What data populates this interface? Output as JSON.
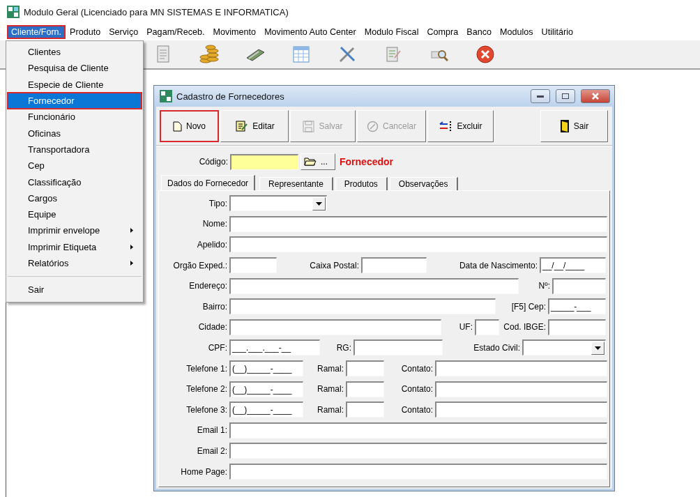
{
  "app": {
    "title": "Modulo Geral (Licenciado para MN SISTEMAS E INFORMATICA)"
  },
  "menubar": [
    {
      "label": "Cliente/Forn.",
      "selected": true,
      "outlined": true
    },
    {
      "label": "Produto",
      "selected": false,
      "outlined": false
    },
    {
      "label": "Serviço",
      "selected": false,
      "outlined": false
    },
    {
      "label": "Pagam/Receb.",
      "selected": false,
      "outlined": false
    },
    {
      "label": "Movimento",
      "selected": false,
      "outlined": false
    },
    {
      "label": "Movimento Auto Center",
      "selected": false,
      "outlined": false
    },
    {
      "label": "Modulo Fiscal",
      "selected": false,
      "outlined": false
    },
    {
      "label": "Compra",
      "selected": false,
      "outlined": false
    },
    {
      "label": "Banco",
      "selected": false,
      "outlined": false
    },
    {
      "label": "Modulos",
      "selected": false,
      "outlined": false
    },
    {
      "label": "Utilitário",
      "selected": false,
      "outlined": false
    }
  ],
  "dropdown": [
    {
      "kind": "item",
      "label": "Clientes",
      "selected": false,
      "outlined": false
    },
    {
      "kind": "item",
      "label": "Pesquisa de Cliente",
      "selected": false,
      "outlined": false
    },
    {
      "kind": "item",
      "label": "Especie de Cliente",
      "selected": false,
      "outlined": false
    },
    {
      "kind": "item",
      "label": "Fornecedor",
      "selected": true,
      "outlined": true
    },
    {
      "kind": "item",
      "label": "Funcionário",
      "selected": false,
      "outlined": false
    },
    {
      "kind": "item",
      "label": "Oficinas",
      "selected": false,
      "outlined": false
    },
    {
      "kind": "item",
      "label": "Transportadora",
      "selected": false,
      "outlined": false
    },
    {
      "kind": "item",
      "label": "Cep",
      "selected": false,
      "outlined": false
    },
    {
      "kind": "item",
      "label": "Classificação",
      "selected": false,
      "outlined": false
    },
    {
      "kind": "item",
      "label": "Cargos",
      "selected": false,
      "outlined": false
    },
    {
      "kind": "item",
      "label": "Equipe",
      "selected": false,
      "outlined": false
    },
    {
      "kind": "submenu",
      "label": "Imprimir envelope",
      "selected": false,
      "outlined": false
    },
    {
      "kind": "submenu",
      "label": "Imprimir Etiqueta",
      "selected": false,
      "outlined": false
    },
    {
      "kind": "submenu",
      "label": "Relatórios",
      "selected": false,
      "outlined": false
    },
    {
      "kind": "separator"
    },
    {
      "kind": "item",
      "label": "Sair",
      "selected": false,
      "outlined": false
    }
  ],
  "dialog": {
    "title": "Cadastro de Fornecedores",
    "buttons": [
      {
        "kind": "new",
        "label": "Novo",
        "disabled": false,
        "outlined": true
      },
      {
        "kind": "edit",
        "label": "Editar",
        "disabled": false,
        "outlined": false
      },
      {
        "kind": "save",
        "label": "Salvar",
        "disabled": true,
        "outlined": false
      },
      {
        "kind": "cancel",
        "label": "Cancelar",
        "disabled": true,
        "outlined": false
      },
      {
        "kind": "delete",
        "label": "Excluir",
        "disabled": false,
        "outlined": false
      },
      {
        "kind": "exit",
        "label": "Sair",
        "disabled": false,
        "outlined": false
      }
    ],
    "code": {
      "label": "Código:",
      "lookup": "...",
      "caption": "Fornecedor"
    },
    "tabs": [
      {
        "label": "Dados do Fornecedor",
        "selected": true
      },
      {
        "label": "Representante",
        "selected": false
      },
      {
        "label": "Produtos",
        "selected": false
      },
      {
        "label": "Observações",
        "selected": false
      }
    ],
    "rows": [
      [
        {
          "label": "Tipo:",
          "kind": "combo"
        }
      ],
      [
        {
          "label": "Nome:",
          "kind": "text"
        }
      ],
      [
        {
          "label": "Apelido:",
          "kind": "text"
        }
      ],
      [
        {
          "label": "Orgão Exped.:",
          "kind": "text"
        },
        {
          "label": "Caixa Postal:",
          "kind": "text"
        },
        {
          "label": "Data de Nascimento:",
          "kind": "text",
          "value": "__/__/____"
        }
      ],
      [
        {
          "label": "Endereço:",
          "kind": "text"
        },
        {
          "label": "Nº:",
          "kind": "text"
        }
      ],
      [
        {
          "label": "Bairro:",
          "kind": "text"
        },
        {
          "label": "[F5] Cep:",
          "kind": "text",
          "value": "_____-___"
        }
      ],
      [
        {
          "label": "Cidade:",
          "kind": "text"
        },
        {
          "label": "UF:",
          "kind": "text"
        },
        {
          "label": "Cod. IBGE:",
          "kind": "text"
        }
      ],
      [
        {
          "label": "CPF:",
          "kind": "text",
          "value": "___.___.___-__"
        },
        {
          "label": "RG:",
          "kind": "text"
        },
        {
          "label": "Estado Civil:",
          "kind": "combo"
        }
      ],
      [
        {
          "label": "Telefone 1:",
          "kind": "text",
          "value": "(__)_____-____"
        },
        {
          "label": "Ramal:",
          "kind": "text"
        },
        {
          "label": "Contato:",
          "kind": "text"
        }
      ],
      [
        {
          "label": "Telefone 2:",
          "kind": "text",
          "value": "(__)_____-____"
        },
        {
          "label": "Ramal:",
          "kind": "text"
        },
        {
          "label": "Contato:",
          "kind": "text"
        }
      ],
      [
        {
          "label": "Telefone 3:",
          "kind": "text",
          "value": "(__)_____-____"
        },
        {
          "label": "Ramal:",
          "kind": "text"
        },
        {
          "label": "Contato:",
          "kind": "text"
        }
      ],
      [
        {
          "label": "Email 1:",
          "kind": "text"
        }
      ],
      [
        {
          "label": "Email 2:",
          "kind": "text"
        }
      ],
      [
        {
          "label": "Home Page:",
          "kind": "text"
        }
      ]
    ]
  }
}
